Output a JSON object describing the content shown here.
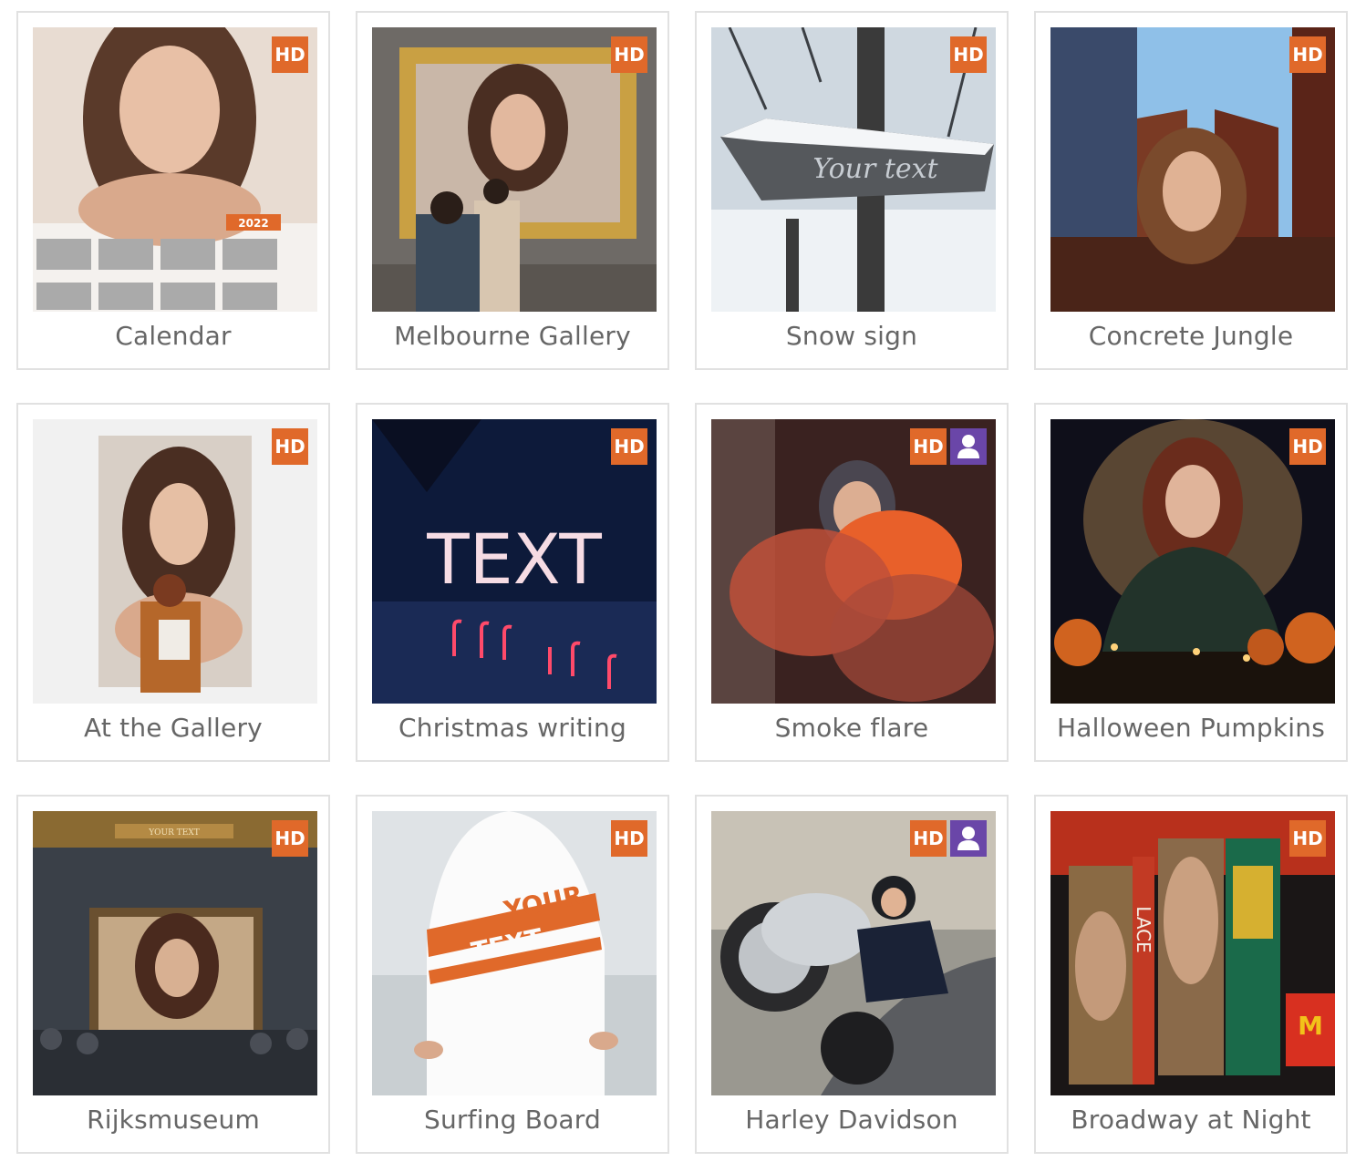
{
  "cards": [
    {
      "title": "Calendar",
      "hd": "HD",
      "scene": "calendar",
      "calendar_year": "2022"
    },
    {
      "title": "Melbourne Gallery",
      "hd": "HD",
      "scene": "gallery-frame"
    },
    {
      "title": "Snow sign",
      "hd": "HD",
      "scene": "snow-sign",
      "sign_text": "Your text"
    },
    {
      "title": "Concrete Jungle",
      "hd": "HD",
      "scene": "city"
    },
    {
      "title": "At the Gallery",
      "hd": "HD",
      "scene": "at-gallery"
    },
    {
      "title": "Christmas writing",
      "hd": "HD",
      "scene": "light-writing",
      "light_text": "TEXT"
    },
    {
      "title": "Smoke flare",
      "hd": "HD",
      "scene": "smoke",
      "user_badge": "user-icon"
    },
    {
      "title": "Halloween Pumpkins",
      "hd": "HD",
      "scene": "pumpkins"
    },
    {
      "title": "Rijksmuseum",
      "hd": "HD",
      "scene": "museum",
      "banner_text": "YOUR TEXT"
    },
    {
      "title": "Surfing Board",
      "hd": "HD",
      "scene": "surfboard",
      "board_text_1": "YOUR",
      "board_text_2": "TEXT"
    },
    {
      "title": "Harley Davidson",
      "hd": "HD",
      "scene": "motorbike",
      "user_badge": "user-icon"
    },
    {
      "title": "Broadway at Night",
      "hd": "HD",
      "scene": "broadway",
      "billboard_text": "LACE"
    }
  ],
  "colors": {
    "hd_badge": "#e0692a",
    "user_badge": "#6a46a8",
    "caption": "#666666",
    "card_border": "#e1e1e1"
  }
}
